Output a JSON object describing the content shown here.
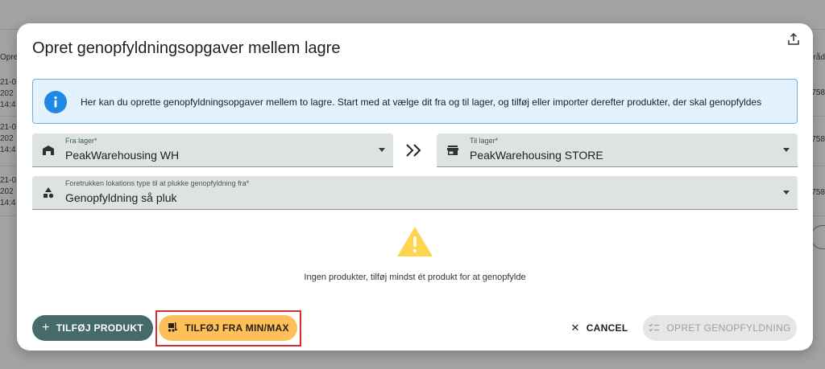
{
  "background": {
    "left_header": "Opre",
    "left_rows": [
      [
        "21-0",
        "202",
        "14:4"
      ],
      [
        "21-0",
        "202",
        "14:4"
      ],
      [
        "21-0",
        "202",
        "14:4"
      ]
    ],
    "right_header": "råd",
    "right_rows": [
      "758",
      "758",
      "758"
    ]
  },
  "dialog": {
    "title": "Opret genopfyldningsopgaver mellem lagre",
    "export_icon": "upload-icon",
    "info": {
      "icon": "info-icon",
      "text": "Her kan du oprette genopfyldningsopgaver mellem to lagre. Start med at vælge dit fra og til lager, og tilføj eller importer derefter produkter, der skal genopfyldes"
    },
    "from_warehouse": {
      "label": "Fra lager*",
      "value": "PeakWarehousing WH",
      "icon": "warehouse-icon"
    },
    "to_warehouse": {
      "label": "Til lager*",
      "value": "PeakWarehousing STORE",
      "icon": "store-icon"
    },
    "location_type": {
      "label": "Foretrukken lokations type til at plukke genopfyldning fra*",
      "value": "Genopfyldning så pluk",
      "icon": "category-icon"
    },
    "empty_state": {
      "icon": "warning-icon",
      "text": "Ingen produkter, tilføj mindst ét produkt for at genopfylde"
    },
    "buttons": {
      "add_product": "TILFØJ PRODUKT",
      "add_from_minmax": "TILFØJ FRA MIN/MAX",
      "cancel": "CANCEL",
      "create": "OPRET GENOPFYLDNING"
    }
  },
  "colors": {
    "primary": "#46696a",
    "accent": "#ffbf59",
    "info_bg": "#e3f2fc",
    "info_border": "#69b1e8",
    "info_icon": "#1e88e5",
    "warning": "#ffd54f",
    "highlight": "#d32f2f"
  }
}
